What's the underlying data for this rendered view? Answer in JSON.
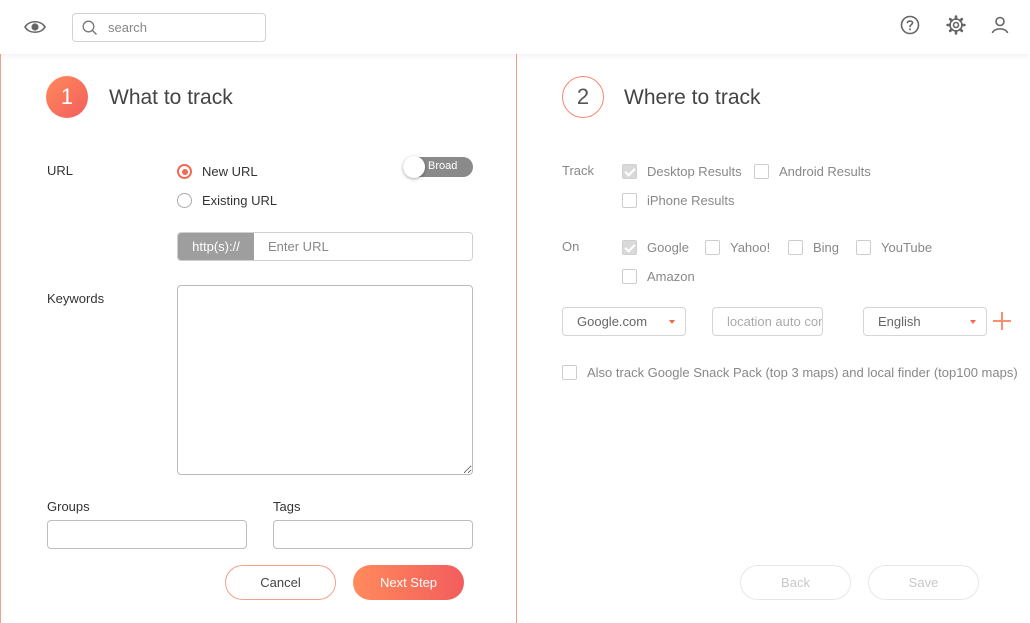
{
  "header": {
    "search_placeholder": "search"
  },
  "step1": {
    "number": "1",
    "title": "What to track",
    "url_label": "URL",
    "url_options": [
      {
        "label": "New URL",
        "selected": true
      },
      {
        "label": "Existing URL",
        "selected": false
      }
    ],
    "match_toggle_label": "Broad",
    "url_prefix": "http(s)://",
    "url_placeholder": "Enter URL",
    "keywords_label": "Keywords",
    "groups_label": "Groups",
    "tags_label": "Tags",
    "cancel_label": "Cancel",
    "next_label": "Next Step"
  },
  "step2": {
    "number": "2",
    "title": "Where to track",
    "track_label": "Track",
    "track_options": [
      {
        "label": "Desktop Results",
        "checked": true
      },
      {
        "label": "Android Results",
        "checked": false
      },
      {
        "label": "iPhone Results",
        "checked": false
      }
    ],
    "on_label": "On",
    "engine_options": [
      {
        "label": "Google",
        "checked": true
      },
      {
        "label": "Yahoo!",
        "checked": false
      },
      {
        "label": "Bing",
        "checked": false
      },
      {
        "label": "YouTube",
        "checked": false
      },
      {
        "label": "Amazon",
        "checked": false
      }
    ],
    "domain_select": "Google.com",
    "location_placeholder": "location auto com",
    "language_select": "English",
    "snack_pack_label": "Also track Google Snack Pack (top 3 maps) and local finder (top100 maps)",
    "snack_pack_checked": false,
    "back_label": "Back",
    "save_label": "Save"
  },
  "colors": {
    "accent": "#f4674f",
    "accent_gradient_start": "#ff8a5c",
    "accent_gradient_end": "#f25d5d",
    "panel_border": "#f3a08e"
  },
  "icons": [
    "eye-icon",
    "search-icon",
    "help-icon",
    "gear-icon",
    "user-icon",
    "plus-icon",
    "chevron-down-icon"
  ]
}
